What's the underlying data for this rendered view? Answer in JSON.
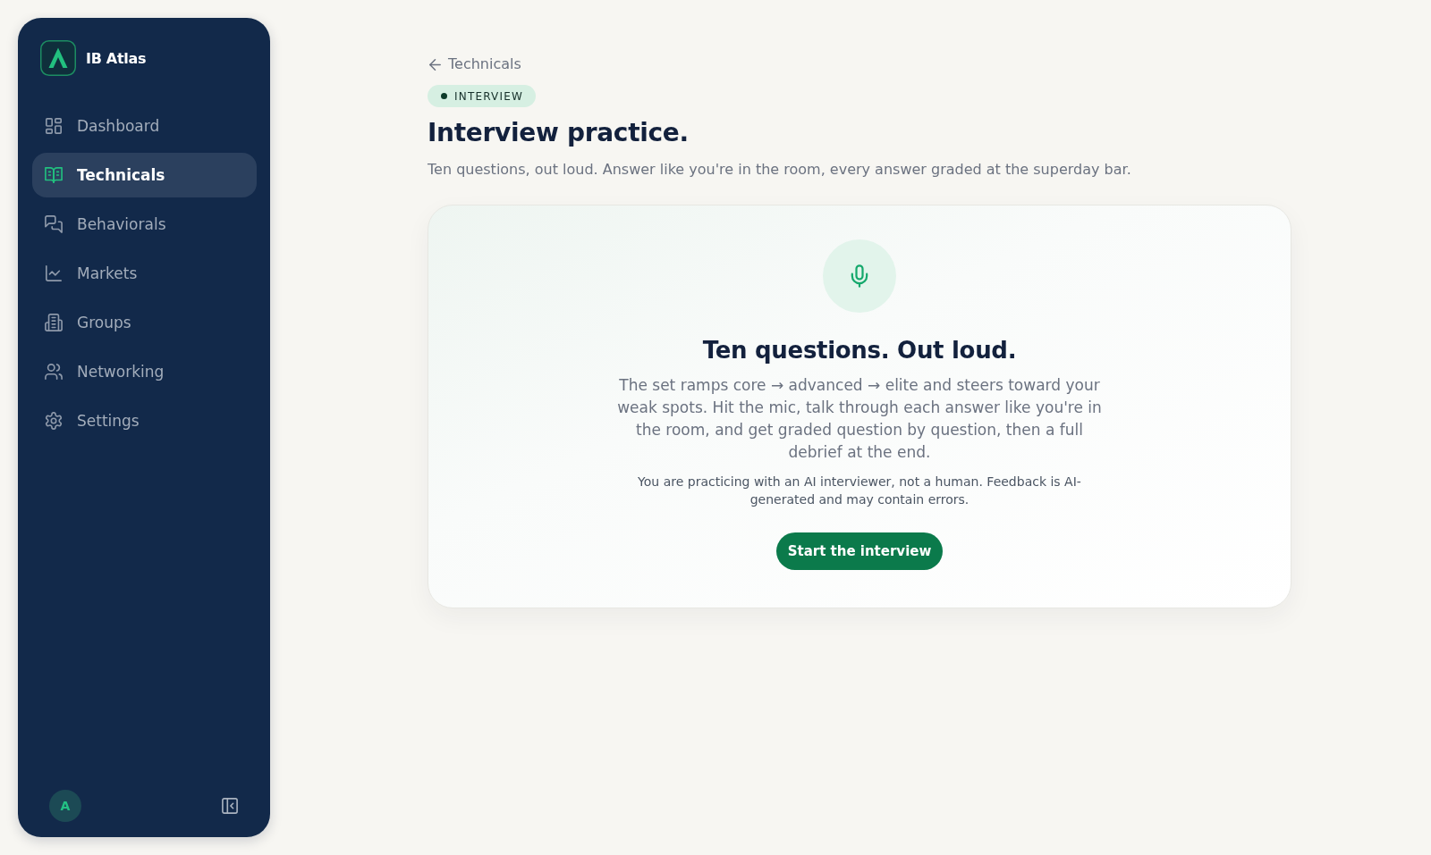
{
  "sidebar": {
    "brand": "IB Atlas",
    "items": [
      {
        "label": "Dashboard",
        "selected": false
      },
      {
        "label": "Technicals",
        "selected": true
      },
      {
        "label": "Behaviorals",
        "selected": false
      },
      {
        "label": "Markets",
        "selected": false
      },
      {
        "label": "Groups",
        "selected": false
      },
      {
        "label": "Networking",
        "selected": false
      },
      {
        "label": "Settings",
        "selected": false
      }
    ],
    "avatar": "A"
  },
  "back_link": "Technicals",
  "badge": "INTERVIEW",
  "title": "Interview practice.",
  "subtitle": "Ten questions, out loud. Answer like you're in the room, every answer graded at the superday bar.",
  "card": {
    "heading": "Ten questions. Out loud.",
    "body": "The set ramps core → advanced → elite and steers toward your weak spots. Hit the mic, talk through each answer like you're in the room, and get graded question by question, then a full debrief at the end.",
    "disclaimer": "You are practicing with an AI interviewer, not a human. Feedback is AI-generated and may contain errors.",
    "button": "Start the interview"
  }
}
